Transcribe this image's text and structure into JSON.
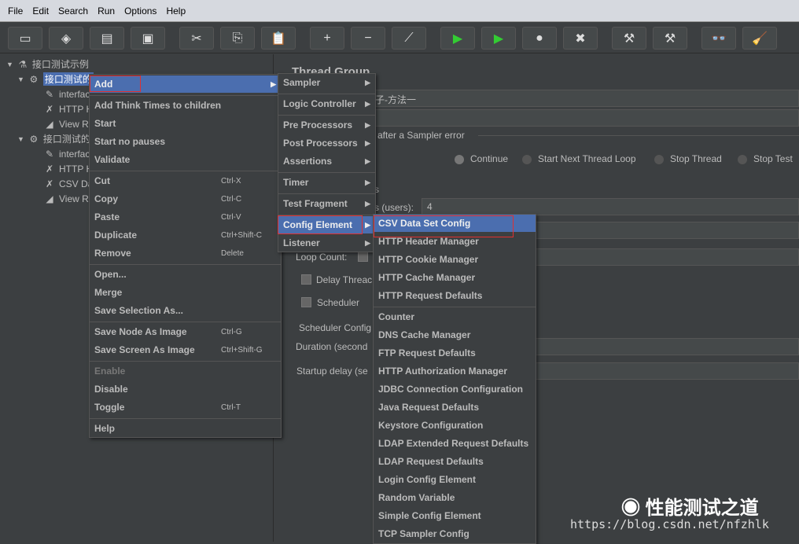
{
  "menubar": [
    "File",
    "Edit",
    "Search",
    "Run",
    "Options",
    "Help"
  ],
  "toolbar": [
    {
      "icon": "new-icon",
      "g": "▭"
    },
    {
      "icon": "templates-icon",
      "g": "◈"
    },
    {
      "icon": "open-icon",
      "g": "▤"
    },
    {
      "icon": "save-icon",
      "g": "▣"
    },
    {
      "icon": "cut-icon",
      "g": "✂"
    },
    {
      "icon": "copy-icon",
      "g": "⎘"
    },
    {
      "icon": "paste-icon",
      "g": "📋"
    },
    {
      "icon": "expand-icon",
      "g": "+"
    },
    {
      "icon": "collapse-icon",
      "g": "−"
    },
    {
      "icon": "toggle-icon",
      "g": "⟋"
    },
    {
      "icon": "start-icon",
      "g": "▶"
    },
    {
      "icon": "start-no-pause-icon",
      "g": "▶"
    },
    {
      "icon": "stop-icon",
      "g": "●"
    },
    {
      "icon": "shutdown-icon",
      "g": "✖"
    },
    {
      "icon": "clear-icon",
      "g": "⚒"
    },
    {
      "icon": "clear-all-icon",
      "g": "⚒"
    },
    {
      "icon": "search-icon",
      "g": "👓"
    },
    {
      "icon": "reset-search-icon",
      "g": "🧹"
    }
  ],
  "tree": [
    {
      "label": "接口测试示例",
      "icon": "test-plan-icon",
      "g": "⚗",
      "level": 0
    },
    {
      "label": "接口测试的",
      "icon": "thread-group-icon",
      "g": "⚙",
      "level": 1,
      "selected": true
    },
    {
      "label": "interface_",
      "icon": "sampler-icon",
      "g": "✎",
      "level": 2
    },
    {
      "label": "HTTP Hea",
      "icon": "config-icon",
      "g": "✗",
      "level": 2
    },
    {
      "label": "View Res",
      "icon": "listener-icon",
      "g": "◢",
      "level": 2
    },
    {
      "label": "接口测试的",
      "icon": "thread-group-icon",
      "g": "⚙",
      "level": 1
    },
    {
      "label": "interface_",
      "icon": "sampler-icon",
      "g": "✎",
      "level": 2
    },
    {
      "label": "HTTP Hea",
      "icon": "config-icon",
      "g": "✗",
      "level": 2
    },
    {
      "label": "CSV Data",
      "icon": "config-icon",
      "g": "✗",
      "level": 2
    },
    {
      "label": "View Res",
      "icon": "listener-icon",
      "g": "◢",
      "level": 2
    }
  ],
  "panel": {
    "title": "Thread Group",
    "name_value": "例子-方法一",
    "error_legend": "after a Sampler error",
    "radios": [
      "Continue",
      "Start Next Thread Loop",
      "Stop Thread",
      "Stop Test"
    ],
    "props_legend": "s",
    "threads_label": "s (users):",
    "threads_value": "4",
    "loop_label": "Loop Count:",
    "delay_label": "Delay Threac",
    "scheduler_label": "Scheduler",
    "sched_legend": "Scheduler Config",
    "duration_label": "Duration (second",
    "startup_label": "Startup delay (se"
  },
  "context_menu": [
    {
      "label": "Add",
      "sub": true,
      "sel": true
    },
    {
      "sep": true
    },
    {
      "label": "Add Think Times to children"
    },
    {
      "label": "Start"
    },
    {
      "label": "Start no pauses"
    },
    {
      "label": "Validate"
    },
    {
      "sep": true
    },
    {
      "label": "Cut",
      "sc": "Ctrl-X"
    },
    {
      "label": "Copy",
      "sc": "Ctrl-C"
    },
    {
      "label": "Paste",
      "sc": "Ctrl-V"
    },
    {
      "label": "Duplicate",
      "sc": "Ctrl+Shift-C"
    },
    {
      "label": "Remove",
      "sc": "Delete"
    },
    {
      "sep": true
    },
    {
      "label": "Open..."
    },
    {
      "label": "Merge"
    },
    {
      "label": "Save Selection As..."
    },
    {
      "sep": true
    },
    {
      "label": "Save Node As Image",
      "sc": "Ctrl-G"
    },
    {
      "label": "Save Screen As Image",
      "sc": "Ctrl+Shift-G"
    },
    {
      "sep": true
    },
    {
      "label": "Enable",
      "dis": true
    },
    {
      "label": "Disable"
    },
    {
      "label": "Toggle",
      "sc": "Ctrl-T"
    },
    {
      "sep": true
    },
    {
      "label": "Help"
    }
  ],
  "add_menu": [
    {
      "label": "Sampler",
      "sub": true
    },
    {
      "sep": true
    },
    {
      "label": "Logic Controller",
      "sub": true
    },
    {
      "sep": true
    },
    {
      "label": "Pre Processors",
      "sub": true
    },
    {
      "label": "Post Processors",
      "sub": true
    },
    {
      "label": "Assertions",
      "sub": true
    },
    {
      "sep": true
    },
    {
      "label": "Timer",
      "sub": true
    },
    {
      "sep": true
    },
    {
      "label": "Test Fragment",
      "sub": true
    },
    {
      "sep": true
    },
    {
      "label": "Config Element",
      "sub": true,
      "sel": true
    },
    {
      "label": "Listener",
      "sub": true
    }
  ],
  "config_menu": [
    {
      "label": "CSV Data Set Config",
      "sel": true
    },
    {
      "label": "HTTP Header Manager"
    },
    {
      "label": "HTTP Cookie Manager"
    },
    {
      "label": "HTTP Cache Manager"
    },
    {
      "label": "HTTP Request Defaults"
    },
    {
      "sep": true
    },
    {
      "label": "Counter"
    },
    {
      "label": "DNS Cache Manager"
    },
    {
      "label": "FTP Request Defaults"
    },
    {
      "label": "HTTP Authorization Manager"
    },
    {
      "label": "JDBC Connection Configuration"
    },
    {
      "label": "Java Request Defaults"
    },
    {
      "label": "Keystore Configuration"
    },
    {
      "label": "LDAP Extended Request Defaults"
    },
    {
      "label": "LDAP Request Defaults"
    },
    {
      "label": "Login Config Element"
    },
    {
      "label": "Random Variable"
    },
    {
      "label": "Simple Config Element"
    },
    {
      "label": "TCP Sampler Config"
    }
  ],
  "watermark": {
    "text": "性能测试之道",
    "url": "https://blog.csdn.net/nfzhlk"
  },
  "colors": {
    "selection": "#4b6eaf",
    "highlight_box": "#e03030",
    "background": "#3c3f41"
  }
}
